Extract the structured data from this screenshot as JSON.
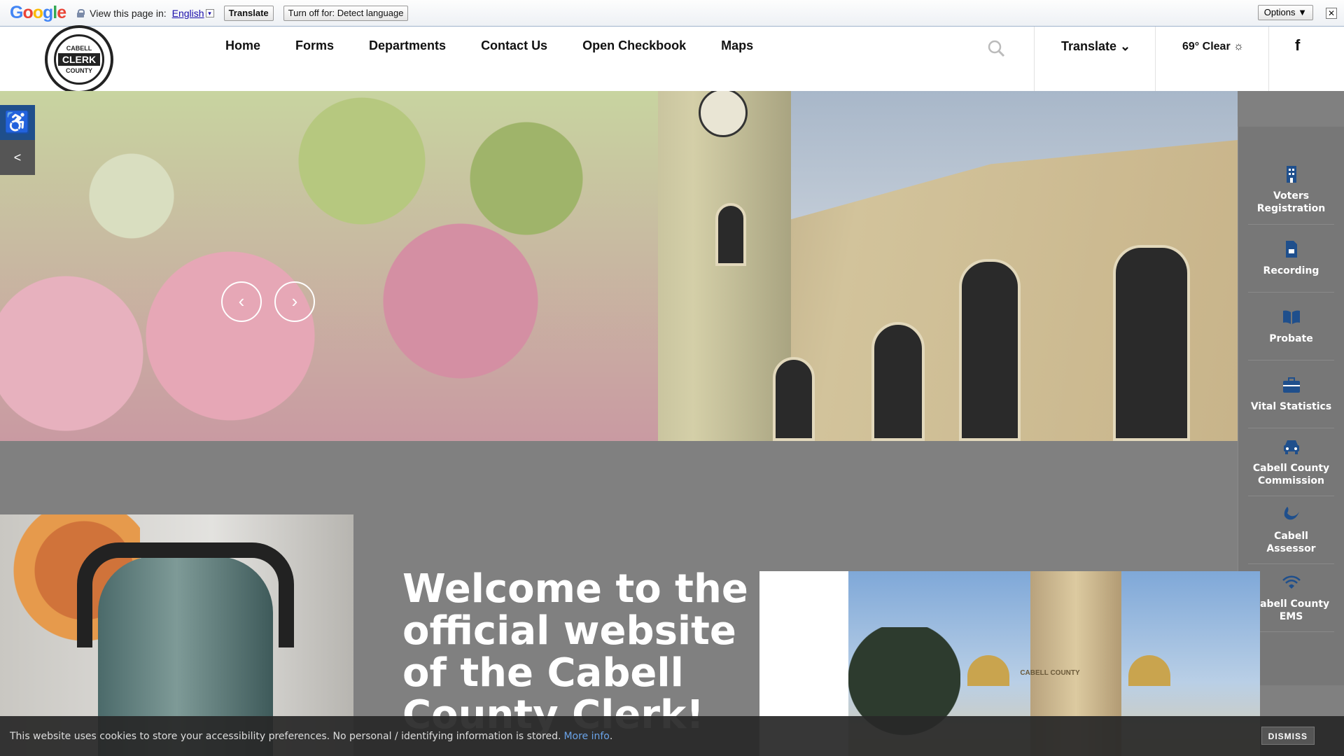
{
  "translate_bar": {
    "logo": "Google",
    "view_text": "View this page in:",
    "language": "English",
    "translate_button": "Translate",
    "turn_off_button": "Turn off for: Detect language",
    "options_button": "Options ▼",
    "close": "✕"
  },
  "header": {
    "logo": {
      "top": "CABELL",
      "band": "CLERK",
      "bottom": "COUNTY"
    },
    "nav": [
      "Home",
      "Forms",
      "Departments",
      "Contact Us",
      "Open Checkbook",
      "Maps"
    ],
    "translate_label": "Translate ⌄",
    "weather": "69° Clear ☼",
    "social": "f"
  },
  "hero": {
    "prev": "‹",
    "next": "›"
  },
  "sidebar_left": {
    "accessibility": "♿",
    "share": "<"
  },
  "quick_links": [
    {
      "label": "Voters Registration",
      "icon": "building-icon"
    },
    {
      "label": "Recording",
      "icon": "document-icon"
    },
    {
      "label": "Probate",
      "icon": "book-icon"
    },
    {
      "label": "Vital Statistics",
      "icon": "briefcase-icon"
    },
    {
      "label": "Cabell County Commission",
      "icon": "car-icon"
    },
    {
      "label": "Cabell Assessor",
      "icon": "swoosh-icon"
    },
    {
      "label": "Cabell County EMS",
      "icon": "signal-icon"
    }
  ],
  "welcome": "Welcome to the official website of the Cabell County Clerk!",
  "court_image_text": "CABELL COUNTY",
  "cookie": {
    "text": "This website uses cookies to store your accessibility preferences. No personal / identifying information is stored.",
    "link": "More info",
    "dismiss": "DISMISS"
  },
  "colors": {
    "accent": "#1f4f8c",
    "sidebar": "#777777",
    "page_bg": "#808080"
  }
}
